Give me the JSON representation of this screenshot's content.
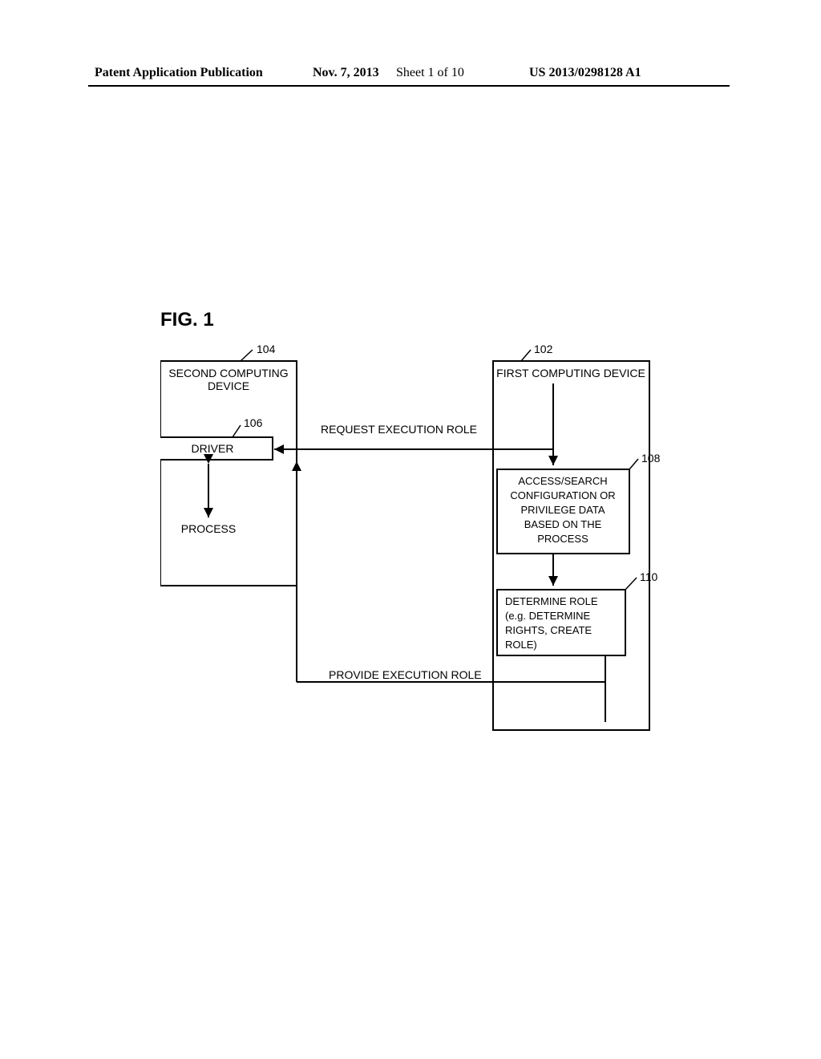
{
  "header": {
    "publication": "Patent Application Publication",
    "date": "Nov. 7, 2013",
    "sheet": "Sheet 1 of 10",
    "docnum": "US 2013/0298128 A1"
  },
  "figure": {
    "title": "FIG. 1",
    "refs": {
      "r102": "102",
      "r104": "104",
      "r106": "106",
      "r108": "108",
      "r110": "110"
    },
    "boxes": {
      "second_device": "SECOND COMPUTING DEVICE",
      "first_device": "FIRST COMPUTING DEVICE",
      "driver": "DRIVER",
      "process": "PROCESS",
      "access_search": "ACCESS/SEARCH CONFIGURATION OR PRIVILEGE DATA BASED ON THE PROCESS",
      "determine_role": "DETERMINE ROLE (e.g. DETERMINE RIGHTS, CREATE ROLE)"
    },
    "arrows": {
      "request": "REQUEST EXECUTION ROLE",
      "provide": "PROVIDE EXECUTION ROLE"
    }
  }
}
